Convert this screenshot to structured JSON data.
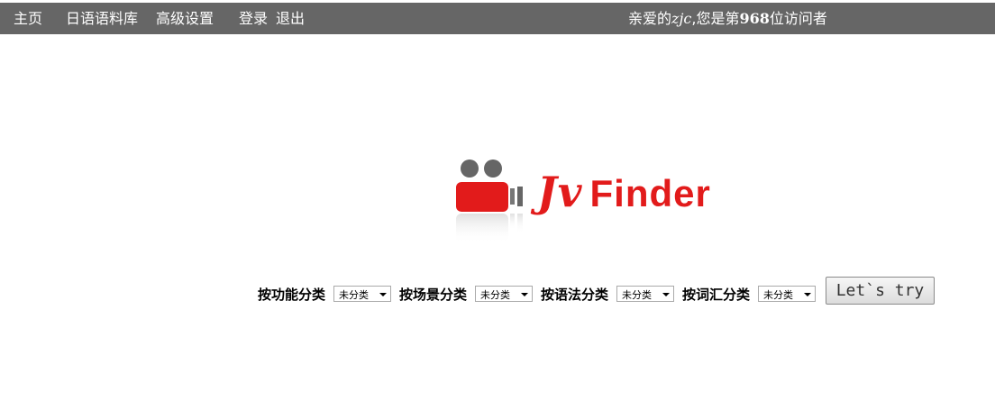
{
  "nav": {
    "home": "主页",
    "corpus": "日语语料库",
    "settings": "高级设置",
    "login": "登录",
    "logout": "退出"
  },
  "welcome": {
    "prefix": "亲爱的",
    "user": "zjc",
    "middle": ",您是第",
    "count": "968",
    "suffix": "位访问者"
  },
  "logo": {
    "jv": "Jv",
    "finder": "Finder"
  },
  "filters": [
    {
      "label": "按功能分类",
      "value": "未分类"
    },
    {
      "label": "按场景分类",
      "value": "未分类"
    },
    {
      "label": "按语法分类",
      "value": "未分类"
    },
    {
      "label": "按词汇分类",
      "value": "未分类"
    }
  ],
  "submit_label": "Let`s try",
  "colors": {
    "topbar": "#666666",
    "brand_red": "#e21b1b"
  }
}
